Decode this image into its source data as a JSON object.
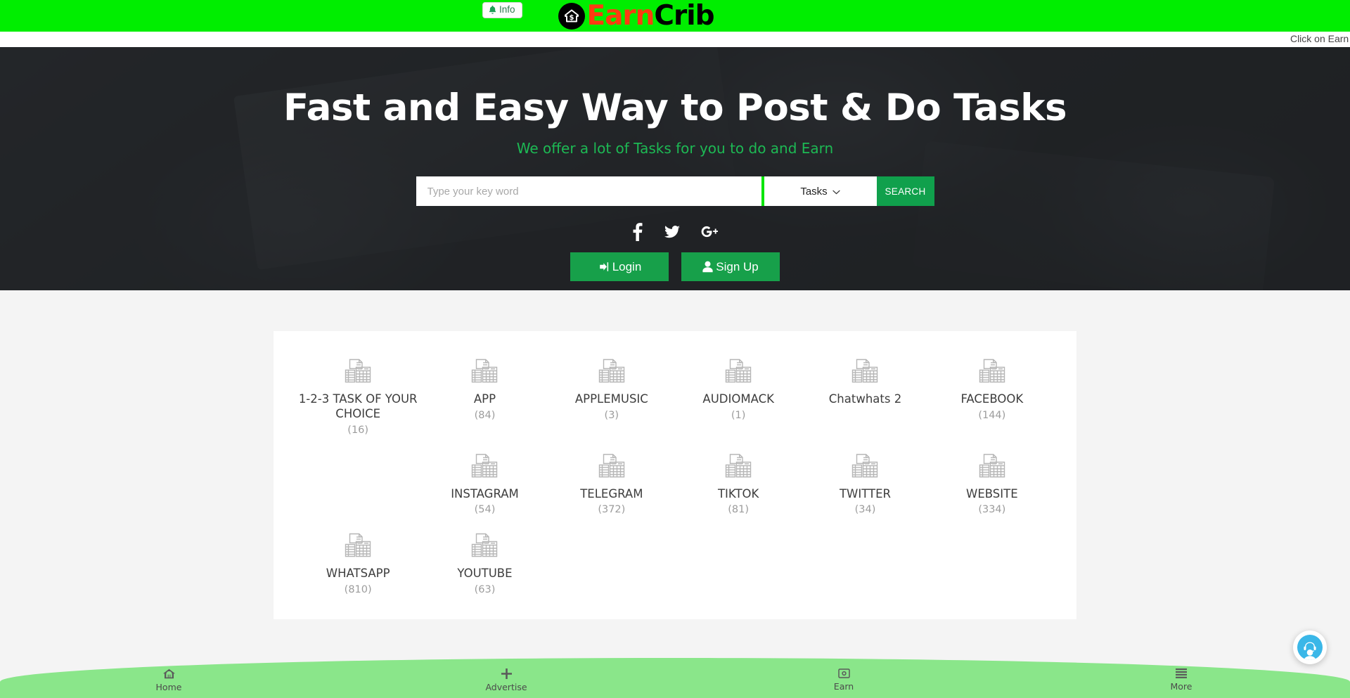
{
  "brand": {
    "name_part1": "Earn",
    "name_part2": "Crib",
    "badge_icon": "house-dollar-icon",
    "colors": {
      "bar": "#00ee00",
      "earn": "#ff3b11",
      "crib": "#000000",
      "accent_green": "#17a04a"
    }
  },
  "header": {
    "info_label": "Info",
    "info_icon": "bell-icon"
  },
  "marquee": {
    "text": "Click on Earn t"
  },
  "hero": {
    "title": "Fast and Easy Way to Post & Do Tasks",
    "subtitle": "We offer a lot of Tasks for you to do and Earn",
    "search": {
      "placeholder": "Type your key word",
      "value": "",
      "select_value": "Tasks",
      "select_options": [
        "Tasks"
      ],
      "chevron_icon": "chevron-down-icon",
      "button_label": "SEARCH"
    },
    "socials": [
      {
        "name": "facebook",
        "icon": "facebook-icon"
      },
      {
        "name": "twitter",
        "icon": "twitter-icon"
      },
      {
        "name": "google-plus",
        "icon": "google-plus-icon"
      }
    ],
    "auth": {
      "login_label": "Login",
      "login_icon": "sign-in-icon",
      "signup_label": "Sign Up",
      "signup_icon": "user-icon"
    }
  },
  "categories": {
    "icon_name": "broken-image-placeholder-icon",
    "items": [
      {
        "name": "1-2-3 TASK OF YOUR CHOICE",
        "count": "(16)"
      },
      {
        "name": "APP",
        "count": "(84)"
      },
      {
        "name": "APPLEMUSIC",
        "count": "(3)"
      },
      {
        "name": "AUDIOMACK",
        "count": "(1)"
      },
      {
        "name": "Chatwhats 2",
        "count": ""
      },
      {
        "name": "FACEBOOK",
        "count": "(144)"
      },
      {
        "name": "",
        "count": ""
      },
      {
        "name": "INSTAGRAM",
        "count": "(54)"
      },
      {
        "name": "TELEGRAM",
        "count": "(372)"
      },
      {
        "name": "TIKTOK",
        "count": "(81)"
      },
      {
        "name": "TWITTER",
        "count": "(34)"
      },
      {
        "name": "WEBSITE",
        "count": "(334)"
      },
      {
        "name": "WHATSAPP",
        "count": "(810)"
      },
      {
        "name": "YOUTUBE",
        "count": "(63)"
      }
    ]
  },
  "chat_widget": {
    "icon": "support-agent-icon"
  },
  "bottom_nav": {
    "items": [
      {
        "label": "Home",
        "icon": "home-icon"
      },
      {
        "label": "Advertise",
        "icon": "plus-icon"
      },
      {
        "label": "Earn",
        "icon": "money-card-icon"
      },
      {
        "label": "More",
        "icon": "list-icon"
      }
    ]
  }
}
